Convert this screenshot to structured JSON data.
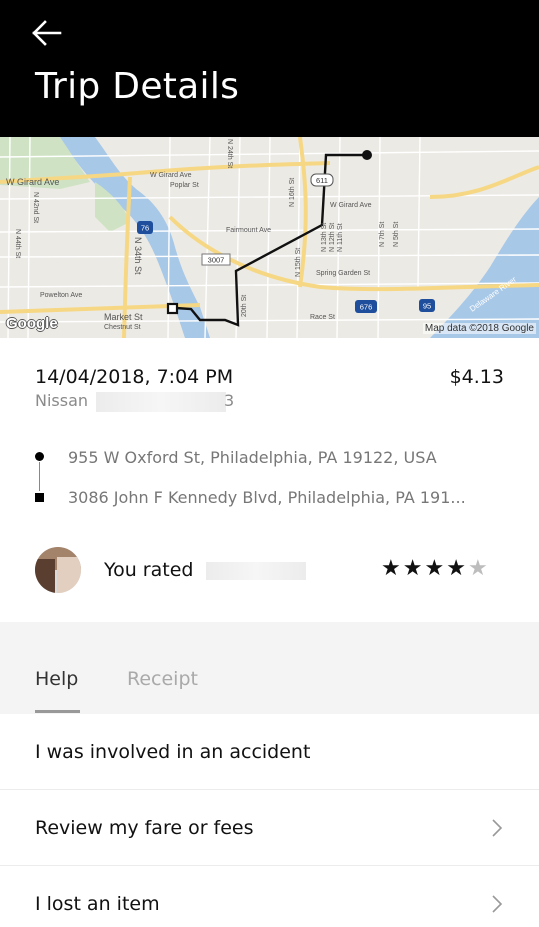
{
  "header": {
    "title": "Trip Details"
  },
  "map": {
    "attribution": "Map data ©2018 Google",
    "logo": "Google",
    "labels": {
      "w_girard": "W Girard Ave",
      "w_girard_2": "W Girard Ave",
      "poplar": "Poplar St",
      "w_girard_3": "W Girard Ave",
      "fairmount": "Fairmount Ave",
      "n34": "N 34th St",
      "n24": "N 24th St",
      "n42": "N 42nd St",
      "n44": "N 44th St",
      "n16": "N 16th St",
      "n15": "N 15th St",
      "n13": "N 13th St",
      "n12": "N 12th St",
      "n11": "N 11th St",
      "n7": "N 7th St",
      "n5": "N 5th St",
      "spring_garden": "Spring Garden St",
      "powelton": "Powelton Ave",
      "market": "Market St",
      "chestnut": "Chestnut St",
      "race": "Race St",
      "s20": "20th St",
      "delaware": "Delaware River",
      "shield_611": "611",
      "shield_76": "76",
      "shield_3007": "3007",
      "shield_676": "676",
      "shield_95": "95"
    }
  },
  "trip": {
    "datetime": "14/04/2018, 7:04 PM",
    "price": "$4.13",
    "vehicle_prefix": "Nissan",
    "vehicle_suffix": "3"
  },
  "route": {
    "pickup": "955 W Oxford St, Philadelphia, PA 19122, USA",
    "dropoff": "3086 John F Kennedy Blvd, Philadelphia, PA 191..."
  },
  "rating": {
    "label": "You rated",
    "stars_filled": 4,
    "stars_total": 5,
    "star_glyph": "★"
  },
  "tabs": [
    {
      "label": "Help",
      "active": true
    },
    {
      "label": "Receipt",
      "active": false
    }
  ],
  "help_items": [
    {
      "label": "I was involved in an accident",
      "has_chevron": false
    },
    {
      "label": "Review my fare or fees",
      "has_chevron": true
    },
    {
      "label": "I lost an item",
      "has_chevron": true
    }
  ],
  "colors": {
    "header_bg": "#000000",
    "route_line": "#111111",
    "tab_active": "#333333",
    "tab_inactive": "#a9a9a9",
    "star_on": "#111111",
    "star_off": "#bdbdbd"
  }
}
